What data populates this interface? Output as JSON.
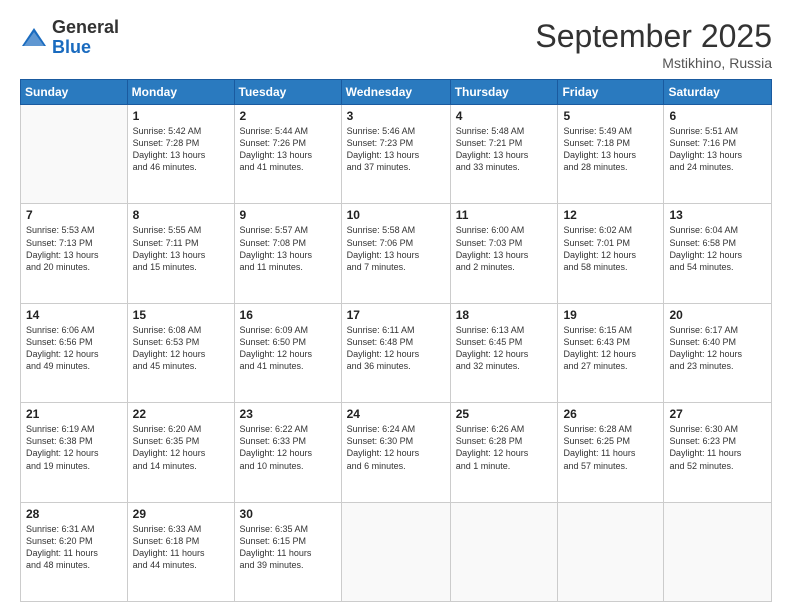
{
  "logo": {
    "general": "General",
    "blue": "Blue"
  },
  "header": {
    "month": "September 2025",
    "location": "Mstikhino, Russia"
  },
  "weekdays": [
    "Sunday",
    "Monday",
    "Tuesday",
    "Wednesday",
    "Thursday",
    "Friday",
    "Saturday"
  ],
  "rows": [
    [
      {
        "day": "",
        "info": ""
      },
      {
        "day": "1",
        "info": "Sunrise: 5:42 AM\nSunset: 7:28 PM\nDaylight: 13 hours\nand 46 minutes."
      },
      {
        "day": "2",
        "info": "Sunrise: 5:44 AM\nSunset: 7:26 PM\nDaylight: 13 hours\nand 41 minutes."
      },
      {
        "day": "3",
        "info": "Sunrise: 5:46 AM\nSunset: 7:23 PM\nDaylight: 13 hours\nand 37 minutes."
      },
      {
        "day": "4",
        "info": "Sunrise: 5:48 AM\nSunset: 7:21 PM\nDaylight: 13 hours\nand 33 minutes."
      },
      {
        "day": "5",
        "info": "Sunrise: 5:49 AM\nSunset: 7:18 PM\nDaylight: 13 hours\nand 28 minutes."
      },
      {
        "day": "6",
        "info": "Sunrise: 5:51 AM\nSunset: 7:16 PM\nDaylight: 13 hours\nand 24 minutes."
      }
    ],
    [
      {
        "day": "7",
        "info": "Sunrise: 5:53 AM\nSunset: 7:13 PM\nDaylight: 13 hours\nand 20 minutes."
      },
      {
        "day": "8",
        "info": "Sunrise: 5:55 AM\nSunset: 7:11 PM\nDaylight: 13 hours\nand 15 minutes."
      },
      {
        "day": "9",
        "info": "Sunrise: 5:57 AM\nSunset: 7:08 PM\nDaylight: 13 hours\nand 11 minutes."
      },
      {
        "day": "10",
        "info": "Sunrise: 5:58 AM\nSunset: 7:06 PM\nDaylight: 13 hours\nand 7 minutes."
      },
      {
        "day": "11",
        "info": "Sunrise: 6:00 AM\nSunset: 7:03 PM\nDaylight: 13 hours\nand 2 minutes."
      },
      {
        "day": "12",
        "info": "Sunrise: 6:02 AM\nSunset: 7:01 PM\nDaylight: 12 hours\nand 58 minutes."
      },
      {
        "day": "13",
        "info": "Sunrise: 6:04 AM\nSunset: 6:58 PM\nDaylight: 12 hours\nand 54 minutes."
      }
    ],
    [
      {
        "day": "14",
        "info": "Sunrise: 6:06 AM\nSunset: 6:56 PM\nDaylight: 12 hours\nand 49 minutes."
      },
      {
        "day": "15",
        "info": "Sunrise: 6:08 AM\nSunset: 6:53 PM\nDaylight: 12 hours\nand 45 minutes."
      },
      {
        "day": "16",
        "info": "Sunrise: 6:09 AM\nSunset: 6:50 PM\nDaylight: 12 hours\nand 41 minutes."
      },
      {
        "day": "17",
        "info": "Sunrise: 6:11 AM\nSunset: 6:48 PM\nDaylight: 12 hours\nand 36 minutes."
      },
      {
        "day": "18",
        "info": "Sunrise: 6:13 AM\nSunset: 6:45 PM\nDaylight: 12 hours\nand 32 minutes."
      },
      {
        "day": "19",
        "info": "Sunrise: 6:15 AM\nSunset: 6:43 PM\nDaylight: 12 hours\nand 27 minutes."
      },
      {
        "day": "20",
        "info": "Sunrise: 6:17 AM\nSunset: 6:40 PM\nDaylight: 12 hours\nand 23 minutes."
      }
    ],
    [
      {
        "day": "21",
        "info": "Sunrise: 6:19 AM\nSunset: 6:38 PM\nDaylight: 12 hours\nand 19 minutes."
      },
      {
        "day": "22",
        "info": "Sunrise: 6:20 AM\nSunset: 6:35 PM\nDaylight: 12 hours\nand 14 minutes."
      },
      {
        "day": "23",
        "info": "Sunrise: 6:22 AM\nSunset: 6:33 PM\nDaylight: 12 hours\nand 10 minutes."
      },
      {
        "day": "24",
        "info": "Sunrise: 6:24 AM\nSunset: 6:30 PM\nDaylight: 12 hours\nand 6 minutes."
      },
      {
        "day": "25",
        "info": "Sunrise: 6:26 AM\nSunset: 6:28 PM\nDaylight: 12 hours\nand 1 minute."
      },
      {
        "day": "26",
        "info": "Sunrise: 6:28 AM\nSunset: 6:25 PM\nDaylight: 11 hours\nand 57 minutes."
      },
      {
        "day": "27",
        "info": "Sunrise: 6:30 AM\nSunset: 6:23 PM\nDaylight: 11 hours\nand 52 minutes."
      }
    ],
    [
      {
        "day": "28",
        "info": "Sunrise: 6:31 AM\nSunset: 6:20 PM\nDaylight: 11 hours\nand 48 minutes."
      },
      {
        "day": "29",
        "info": "Sunrise: 6:33 AM\nSunset: 6:18 PM\nDaylight: 11 hours\nand 44 minutes."
      },
      {
        "day": "30",
        "info": "Sunrise: 6:35 AM\nSunset: 6:15 PM\nDaylight: 11 hours\nand 39 minutes."
      },
      {
        "day": "",
        "info": ""
      },
      {
        "day": "",
        "info": ""
      },
      {
        "day": "",
        "info": ""
      },
      {
        "day": "",
        "info": ""
      }
    ]
  ]
}
